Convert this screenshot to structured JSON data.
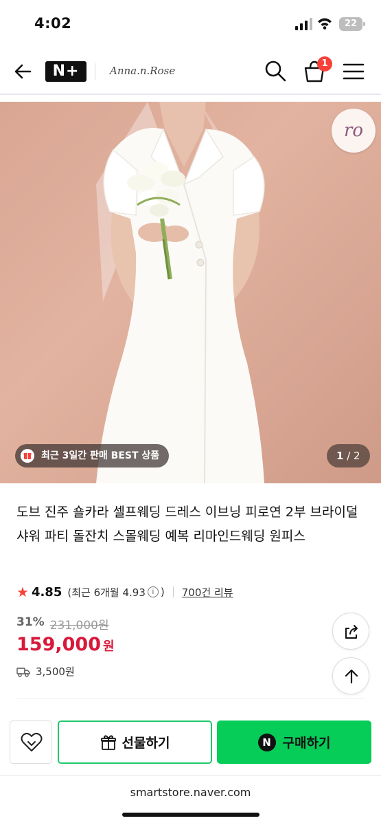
{
  "status_bar": {
    "time": "4:02",
    "battery": "22"
  },
  "header": {
    "logo": "N+",
    "store_name": "Anna.n.Rose",
    "cart_count": "1"
  },
  "hero": {
    "brand_badge": "ro",
    "best_tag": "최근 3일간 판매 BEST 상품",
    "counter_current": "1",
    "counter_total": "/ 2"
  },
  "product": {
    "title": "도브 진주 숄카라 셀프웨딩 드레스 이브닝 피로연 2부 브라이덜샤워 파티 돌잔치 스몰웨딩 예복 리마인드웨딩 원피스",
    "rating": "4.85",
    "recent_rating_prefix": "(최근 6개월 4.93",
    "recent_rating_suffix": ")",
    "review_count": "700건 리뷰",
    "discount_pct": "31%",
    "original_price": "231,000원",
    "price": "159,000",
    "price_unit": "원",
    "shipping": "3,500원"
  },
  "actions": {
    "gift": "선물하기",
    "buy": "구매하기",
    "buy_badge": "N"
  },
  "footer": {
    "url": "smartstore.naver.com"
  }
}
